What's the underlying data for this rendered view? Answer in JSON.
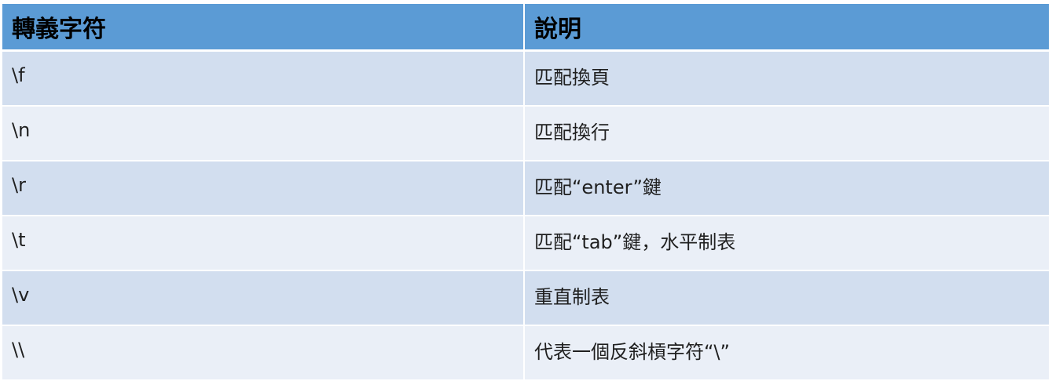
{
  "colors": {
    "header_bg": "#5b9bd5",
    "row_dark": "#d2deef",
    "row_light": "#eaeff7"
  },
  "table": {
    "headers": [
      "轉義字符",
      "說明"
    ],
    "rows": [
      {
        "char": "\\f",
        "desc": "匹配換頁"
      },
      {
        "char": "\\n",
        "desc": "匹配換行"
      },
      {
        "char": "\\r",
        "desc": "匹配“enter”鍵"
      },
      {
        "char": "\\t",
        "desc": "匹配“tab”鍵，水平制表"
      },
      {
        "char": "\\v",
        "desc": "重直制表"
      },
      {
        "char": "\\\\",
        "desc": "代表一個反斜槓字符“\\”"
      }
    ]
  }
}
